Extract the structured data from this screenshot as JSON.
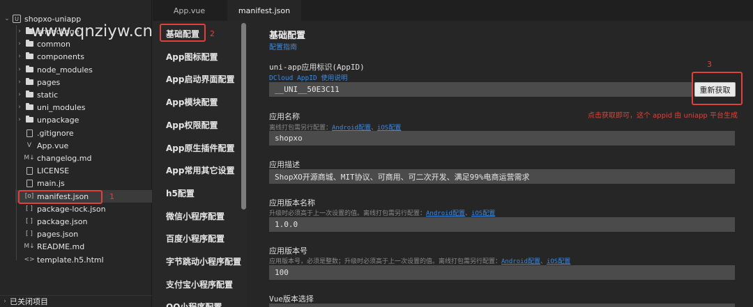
{
  "explorer": {
    "project": "shopxo-uniapp",
    "items": [
      {
        "name": "unpackage_hbuilder",
        "label": "unpackage",
        "type": "folder"
      },
      {
        "name": "common",
        "label": "common",
        "type": "folder"
      },
      {
        "name": "components",
        "label": "components",
        "type": "folder"
      },
      {
        "name": "node_modules",
        "label": "node_modules",
        "type": "folder"
      },
      {
        "name": "pages",
        "label": "pages",
        "type": "folder"
      },
      {
        "name": "static",
        "label": "static",
        "type": "folder"
      },
      {
        "name": "uni_modules",
        "label": "uni_modules",
        "type": "folder"
      },
      {
        "name": "unpackage",
        "label": "unpackage",
        "type": "folder"
      },
      {
        "name": "gitignore",
        "label": ".gitignore",
        "type": "file"
      },
      {
        "name": "app-vue",
        "label": "App.vue",
        "type": "vue"
      },
      {
        "name": "changelog",
        "label": "changelog.md",
        "type": "md"
      },
      {
        "name": "license",
        "label": "LICENSE",
        "type": "file"
      },
      {
        "name": "main-js",
        "label": "main.js",
        "type": "file"
      },
      {
        "name": "manifest-json",
        "label": "manifest.json",
        "type": "json"
      },
      {
        "name": "package-lock",
        "label": "package-lock.json",
        "type": "json"
      },
      {
        "name": "package-json",
        "label": "package.json",
        "type": "json"
      },
      {
        "name": "pages-json",
        "label": "pages.json",
        "type": "json"
      },
      {
        "name": "readme",
        "label": "README.md",
        "type": "md"
      },
      {
        "name": "template",
        "label": "template.h5.html",
        "type": "html"
      }
    ],
    "icon_glyphs": {
      "md": "M↓",
      "json": "[ ]",
      "json_active": "[o]",
      "vue": "V",
      "html": "<>",
      "project": "U"
    },
    "closed_projects": "已关闭项目"
  },
  "watermark": "www.qnziyw.cn",
  "tabs": [
    {
      "label": "App.vue",
      "active": false
    },
    {
      "label": "manifest.json",
      "active": true
    }
  ],
  "settings_nav": [
    "基础配置",
    "App图标配置",
    "App启动界面配置",
    "App模块配置",
    "App权限配置",
    "App原生插件配置",
    "App常用其它设置",
    "h5配置",
    "微信小程序配置",
    "百度小程序配置",
    "字节跳动小程序配置",
    "支付宝小程序配置",
    "QQ小程序配置"
  ],
  "annotations": {
    "n1": "1",
    "n2": "2",
    "n3": "3",
    "note": "点击获取即可，这个 appid 由 uniapp 平台生成"
  },
  "form": {
    "title": "基础配置",
    "guide_link": "配置指南",
    "appid": {
      "label": "uni-app应用标识(AppID)",
      "hint_prefix": "DCloud AppID",
      "hint_link": "使用说明",
      "value": "__UNI__50E3C11",
      "button": "重新获取"
    },
    "app_name": {
      "label": "应用名称",
      "hint_prefix": "离线打包需另行配置：",
      "link_android": "Android配置",
      "sep": "、",
      "link_ios": "iOS配置",
      "value": "shopxo"
    },
    "app_desc": {
      "label": "应用描述",
      "value": "ShopXO开源商城、MIT协议、可商用、可二次开发、满足99%电商运营需求"
    },
    "version_name": {
      "label": "应用版本名称",
      "hint_prefix": "升级时必须高于上一次设置的值。离线打包需另行配置：",
      "link_android": "Android配置",
      "sep": "、",
      "link_ios": "iOS配置",
      "value": "1.0.0"
    },
    "version_code": {
      "label": "应用版本号",
      "hint_prefix": "应用版本号，必须是整数；升级时必须高于上一次设置的值。离线打包需另行配置：",
      "link_android": "Android配置",
      "sep": "、",
      "link_ios": "iOS配置",
      "value": "100"
    },
    "vue_version": {
      "label": "Vue版本选择"
    }
  }
}
